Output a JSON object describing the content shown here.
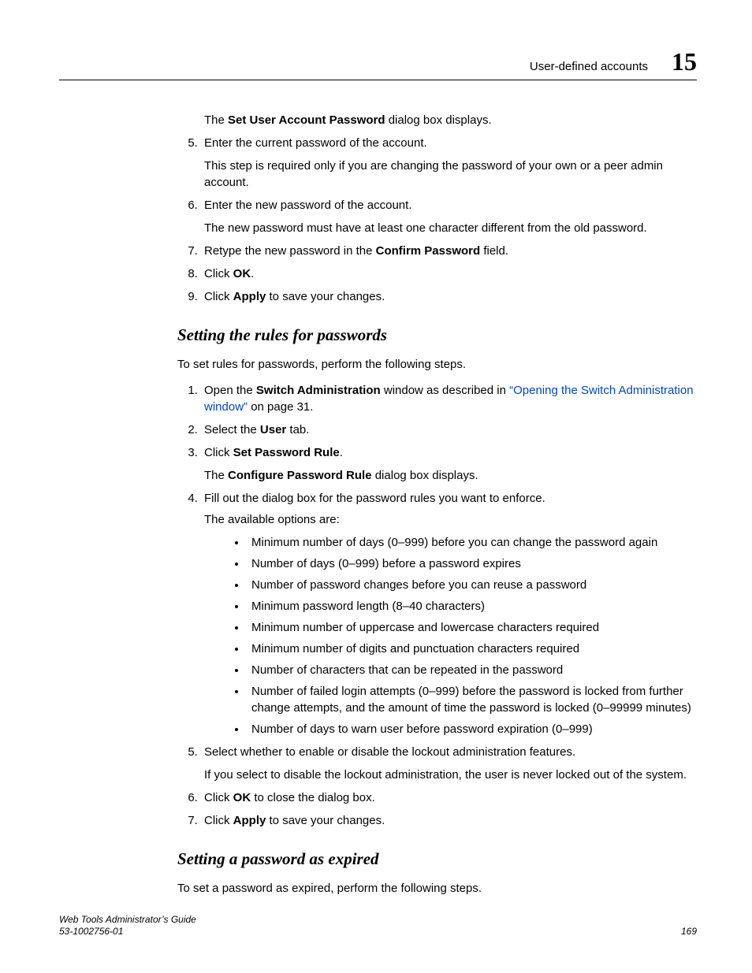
{
  "header": {
    "running_head": "User-defined accounts",
    "chapter_number": "15"
  },
  "continuation": {
    "dialog_pre": "The ",
    "dialog_name": "Set User Account Password",
    "dialog_post": " dialog box displays.",
    "step5": "Enter the current password of the account.",
    "step5_note": "This step is required only if you are changing the password of your own or a peer admin account.",
    "step6": "Enter the new password of the account.",
    "step6_note": "The new password must have at least one character different from the old password.",
    "step7_pre": "Retype the new password in the ",
    "step7_bold": "Confirm Password",
    "step7_post": " field.",
    "step8_pre": "Click ",
    "step8_bold": "OK",
    "step8_post": ".",
    "step9_pre": "Click ",
    "step9_bold": "Apply",
    "step9_post": " to save your changes."
  },
  "rules": {
    "title": "Setting the rules for passwords",
    "intro": "To set rules for passwords, perform the following steps.",
    "step1_pre": "Open the ",
    "step1_bold": "Switch Administration",
    "step1_mid": " window as described in ",
    "step1_link": "“Opening the Switch Administration window”",
    "step1_post": " on page 31.",
    "step2_pre": "Select the ",
    "step2_bold": "User",
    "step2_post": " tab.",
    "step3_pre": "Click ",
    "step3_bold": "Set Password Rule",
    "step3_post": ".",
    "step3_note_pre": "The ",
    "step3_note_bold": "Configure Password Rule",
    "step3_note_post": " dialog box displays.",
    "step4": "Fill out the dialog box for the password rules you want to enforce.",
    "step4_sub": "The available options are:",
    "bullets": [
      "Minimum number of days (0–999) before you can change the password again",
      "Number of days (0–999) before a password expires",
      "Number of password changes before you can reuse a password",
      "Minimum password length (8–40 characters)",
      "Minimum number of uppercase and lowercase characters required",
      "Minimum number of digits and punctuation characters required",
      "Number of characters that can be repeated in the password",
      "Number of failed login attempts (0–999) before the password is locked from further change attempts, and the amount of time the password is locked (0–99999 minutes)",
      "Number of days to warn user before password expiration (0–999)"
    ],
    "step5": "Select whether to enable or disable the lockout administration features.",
    "step5_note": "If you select to disable the lockout administration, the user is never locked out of the system.",
    "step6_pre": "Click ",
    "step6_bold": "OK",
    "step6_post": " to close the dialog box.",
    "step7_pre": "Click ",
    "step7_bold": "Apply",
    "step7_post": " to save your changes."
  },
  "expired": {
    "title": "Setting a password as expired",
    "intro": "To set a password as expired, perform the following steps."
  },
  "footer": {
    "book_title": "Web Tools Administrator’s Guide",
    "doc_number": "53-1002756-01",
    "page_number": "169"
  }
}
